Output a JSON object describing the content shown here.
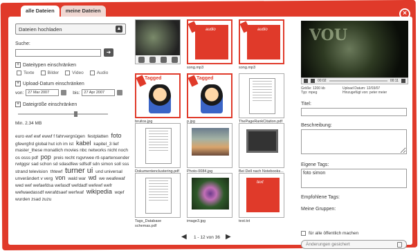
{
  "tabs": [
    "alle Dateien",
    "meine Dateien"
  ],
  "left": {
    "upload_label": "Dateien hochladen",
    "search_label": "Suche:",
    "search_value": "",
    "types_label": "Dateitypen einschränken",
    "types": [
      "Texte",
      "Bilder",
      "Video",
      "Audio"
    ],
    "date_label": "Upload-Datum einschränken",
    "from_label": "von:",
    "from_value": "27 Mar 2007",
    "to_label": "bis:",
    "to_value": "27 Apr 2007",
    "size_label": "Dateigröße einschränken",
    "min_size": "Min. 2.34 MB",
    "size_fraction": 0.65,
    "tagcloud": [
      {
        "t": "euro ewf ewf ewwf f fahrvergnügen",
        "s": "n"
      },
      {
        "t": "festplatten",
        "s": "n"
      },
      {
        "t": "foto",
        "s": "l"
      },
      {
        "t": "gfewrgfrd global hut ich im ist",
        "s": "n"
      },
      {
        "t": "kabel",
        "s": "l"
      },
      {
        "t": "kapitel_3 lief master_these monatlich movies nbc networks nicht noch os osss pdf",
        "s": "n"
      },
      {
        "t": "pop",
        "s": "l"
      },
      {
        "t": "preis recht rsgvrwee rtl-spartensender rwtggsr sad schon sd sdasdfew sdfsdf sdn simon soll sss strand television",
        "s": "n"
      },
      {
        "t": "thtewf",
        "s": "n"
      },
      {
        "t": "turner ui",
        "s": "xl"
      },
      {
        "t": "und universal unverändert v verg",
        "s": "n"
      },
      {
        "t": "von",
        "s": "l"
      },
      {
        "t": "wald war",
        "s": "n"
      },
      {
        "t": "wd",
        "s": "l"
      },
      {
        "t": "we weafewaf wed wef wefaefdsa wefasdf wefdadf wefewf wefr wefwaedassdf werafdsaef werfwaf",
        "s": "n"
      },
      {
        "t": "wikipedia",
        "s": "l"
      },
      {
        "t": "wqef wurden zsad zuzu",
        "s": "n"
      }
    ]
  },
  "grid": {
    "items": [
      {
        "caption": "",
        "kind": "video",
        "selected": false
      },
      {
        "caption": "song.mp3",
        "kind": "audio",
        "selected": true
      },
      {
        "caption": "song.mp3",
        "kind": "audio",
        "selected": true
      },
      {
        "caption": "bruitos.jpg",
        "kind": "cartoon",
        "selected": true,
        "tag": "Tagged"
      },
      {
        "caption": "p.jpg",
        "kind": "cartoon",
        "selected": true,
        "tag": "Tagged"
      },
      {
        "caption": "ThePageRankCitation.pdf",
        "kind": "doc",
        "selected": false
      },
      {
        "caption": "Dokumentenclustering.pdf",
        "kind": "doc",
        "selected": false
      },
      {
        "caption": "Photo-0084.jpg",
        "kind": "crowd",
        "selected": false
      },
      {
        "caption": "Bei Dell nach Notebooks...",
        "kind": "monitor",
        "selected": false
      },
      {
        "caption": "Tags_Database schemas.pdf",
        "kind": "doc",
        "selected": false
      },
      {
        "caption": "image3.jpg",
        "kind": "flower",
        "selected": false
      },
      {
        "caption": "test.txt",
        "kind": "text",
        "selected": false
      }
    ],
    "audio_label": "audio",
    "text_label": "text",
    "pager": "1 - 12 von 36"
  },
  "right": {
    "video_overlay": "VOU",
    "time_current": "00:02",
    "time_total": "00:11",
    "meta": [
      "Größe: 1200 kb",
      "Upload Datum: 12/03/07",
      "Typ: mpeg",
      "Hinzugefügt von: peter meier"
    ],
    "title_label": "Titel:",
    "title_value": "",
    "desc_label": "Beschreibung:",
    "tags_label": "Eigene Tags:",
    "tags_value": "foto simon",
    "suggested_label": "Empfohlene Tags:",
    "groups_label": "Meine Gruppen:",
    "public_label": "für alle öffentlich machen",
    "save_label": "Änderungen gesichert"
  },
  "colors": {
    "accent": "#e03a2a"
  }
}
